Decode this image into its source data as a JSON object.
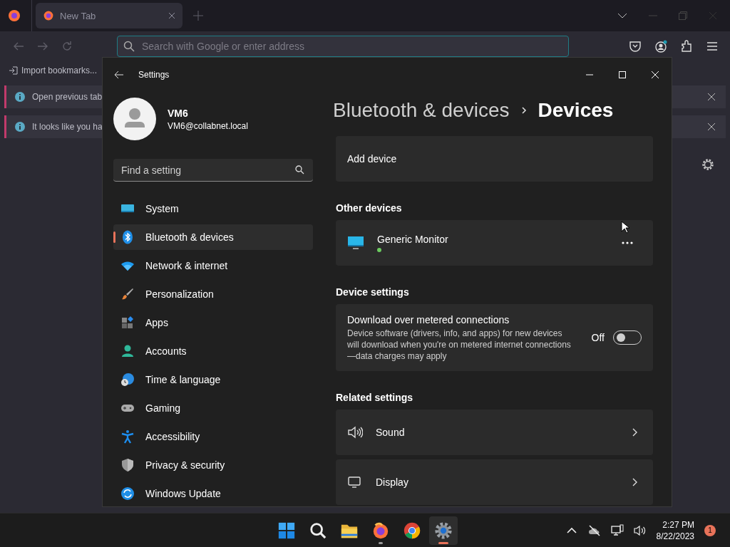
{
  "browser": {
    "tabs": [
      {
        "label": "New Tab",
        "selected": true
      }
    ],
    "address_bar": {
      "placeholder": "Search with Google or enter address"
    },
    "bookmarks_bar": {
      "items": [
        "Import bookmarks..."
      ]
    },
    "notifications": [
      {
        "text": "Open previous tab"
      },
      {
        "text": "It looks like you ha"
      }
    ]
  },
  "settings_window": {
    "title": "Settings",
    "user": {
      "name": "VM6",
      "email": "VM6@collabnet.local"
    },
    "search": {
      "placeholder": "Find a setting"
    },
    "nav": [
      {
        "label": "System",
        "kind": "system",
        "selected": false
      },
      {
        "label": "Bluetooth & devices",
        "kind": "bluetooth",
        "selected": true
      },
      {
        "label": "Network & internet",
        "kind": "network",
        "selected": false
      },
      {
        "label": "Personalization",
        "kind": "personalization",
        "selected": false
      },
      {
        "label": "Apps",
        "kind": "apps",
        "selected": false
      },
      {
        "label": "Accounts",
        "kind": "accounts",
        "selected": false
      },
      {
        "label": "Time & language",
        "kind": "time",
        "selected": false
      },
      {
        "label": "Gaming",
        "kind": "gaming",
        "selected": false
      },
      {
        "label": "Accessibility",
        "kind": "accessibility",
        "selected": false
      },
      {
        "label": "Privacy & security",
        "kind": "privacy",
        "selected": false
      },
      {
        "label": "Windows Update",
        "kind": "update",
        "selected": false
      }
    ],
    "breadcrumb": {
      "parent": "Bluetooth & devices",
      "current": "Devices"
    },
    "add_device": {
      "label": "Add device"
    },
    "other_devices": {
      "heading": "Other devices",
      "devices": [
        {
          "name": "Generic Monitor"
        }
      ]
    },
    "device_settings": {
      "heading": "Device settings",
      "items": [
        {
          "title": "Download over metered connections",
          "description": "Device software (drivers, info, and apps) for new devices will download when you're on metered internet connections—data charges may apply",
          "state_label": "Off",
          "on": false
        }
      ]
    },
    "related_settings": {
      "heading": "Related settings",
      "items": [
        {
          "label": "Sound",
          "kind": "sound"
        },
        {
          "label": "Display",
          "kind": "display"
        }
      ]
    }
  },
  "taskbar": {
    "apps": [
      {
        "kind": "start",
        "running": false,
        "active": false
      },
      {
        "kind": "search",
        "running": false,
        "active": false
      },
      {
        "kind": "explorer",
        "running": false,
        "active": false
      },
      {
        "kind": "firefox",
        "running": true,
        "active": false
      },
      {
        "kind": "chrome",
        "running": false,
        "active": false
      },
      {
        "kind": "settings",
        "running": true,
        "active": true
      }
    ],
    "time": "2:27 PM",
    "date": "8/22/2023",
    "notification_count": "1"
  }
}
